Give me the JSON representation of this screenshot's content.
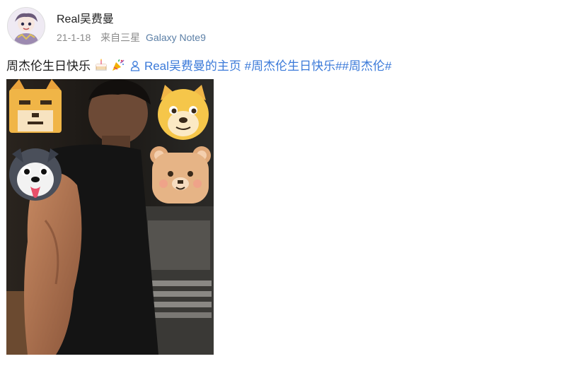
{
  "post": {
    "username": "Real吴费曼",
    "date": "21-1-18",
    "source_prefix": "来自三星",
    "device": "Galaxy Note9",
    "text": "周杰伦生日快乐",
    "mention": "Real吴费曼的主页",
    "hashtags": "#周杰伦生日快乐##周杰伦#"
  },
  "icons": {
    "cake": "cake-emoji-icon",
    "party": "party-popper-emoji-icon",
    "user": "user-icon"
  },
  "colors": {
    "link": "#3b7ad9",
    "meta": "#8a8a8a",
    "device": "#5b7fa6"
  }
}
